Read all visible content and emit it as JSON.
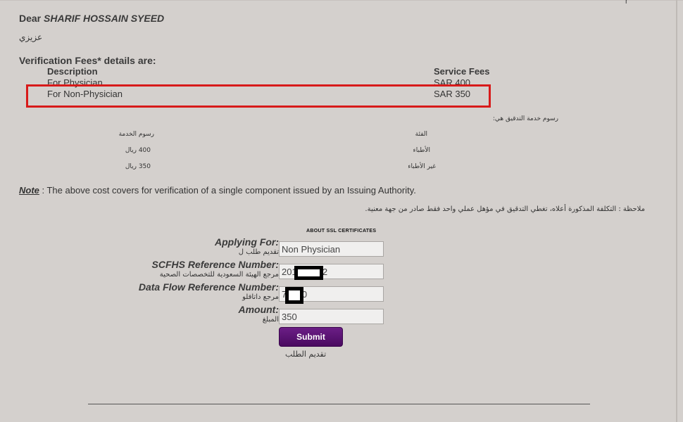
{
  "corner_char": "r",
  "greeting": {
    "prefix": "Dear ",
    "name": "SHARIF HOSSAIN SYEED",
    "arabic": "عزيزي"
  },
  "fees": {
    "title": "Verification Fees* details are:",
    "headers": {
      "description": "Description",
      "service_fees": "Service Fees"
    },
    "rows": [
      {
        "description": "For Physician",
        "fee": "SAR 400"
      },
      {
        "description": "For Non-Physician",
        "fee": "SAR 350"
      }
    ],
    "highlight_color": "#d81a1a"
  },
  "arabic_fees": {
    "title": "رسوم خدمة التدقيق هي:",
    "headers": {
      "service_fees": "رسوم الخدمة",
      "category": "الفئة"
    },
    "rows": [
      {
        "fee": "400 ريال",
        "category": "الأطباء"
      },
      {
        "fee": "350 ريال",
        "category": "غير الأطباء"
      }
    ]
  },
  "note": {
    "label": "Note",
    "text": " : The above cost covers for verification of a single component issued by an Issuing Authority.",
    "arabic": "ملاحظة : التكلفة المذكورة أعلاه، تغطي التدقيق في مؤهل عملي واحد فقط صادر من جهة معنية."
  },
  "ssl_link": "ABOUT SSL CERTIFICATES",
  "form": {
    "applying_for": {
      "label": "Applying For:",
      "arabic": "تقديم طلب ل",
      "value": "Non Physician"
    },
    "scfhs_ref": {
      "label": "SCFHS Reference Number:",
      "arabic": "مرجع الهيئة السعودية للتخصصات الصحية",
      "value": "201        82"
    },
    "dataflow_ref": {
      "label": "Data Flow Reference Number:",
      "arabic": "مرجع داتافلو",
      "value": "7      0"
    },
    "amount": {
      "label": "Amount:",
      "arabic": "المبلغ",
      "value": "350"
    },
    "submit": {
      "label": "Submit",
      "arabic": "تقديم الطلب",
      "color": "#5a0f74"
    }
  }
}
